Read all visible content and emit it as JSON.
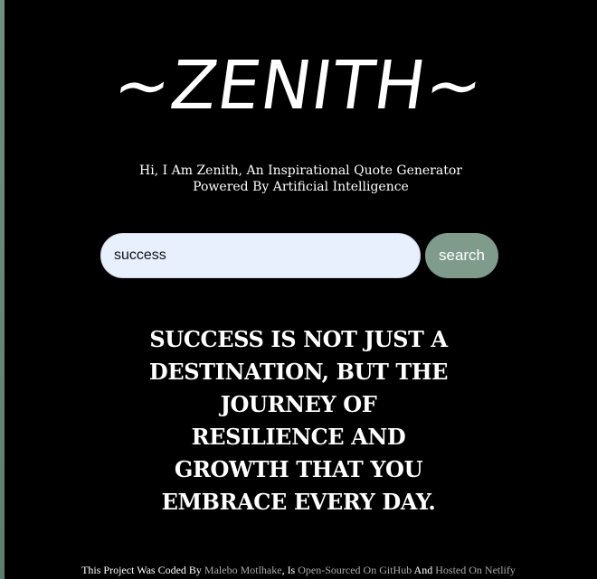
{
  "app": {
    "logo_text": "~ZENITH~",
    "tagline": "Hi, I Am Zenith, An Inspirational Quote Generator Powered By Artificial Intelligence"
  },
  "search": {
    "value": "success",
    "button_label": "search"
  },
  "quote": {
    "text": "SUCCESS IS NOT JUST A DESTINATION, BUT THE JOURNEY OF RESILIENCE AND GROWTH THAT YOU EMBRACE EVERY DAY."
  },
  "footer": {
    "prefix": "This Project Was Coded By ",
    "author_link": "Malebo Motlhake",
    "mid": ", Is ",
    "github_link": "Open-Sourced On GitHub",
    "and": " And ",
    "netlify_link": "Hosted On Netlify"
  },
  "colors": {
    "background": "#000000",
    "accent": "#7f9b8c",
    "input_bg": "#e8f0fe",
    "link": "#a9a9a9"
  }
}
